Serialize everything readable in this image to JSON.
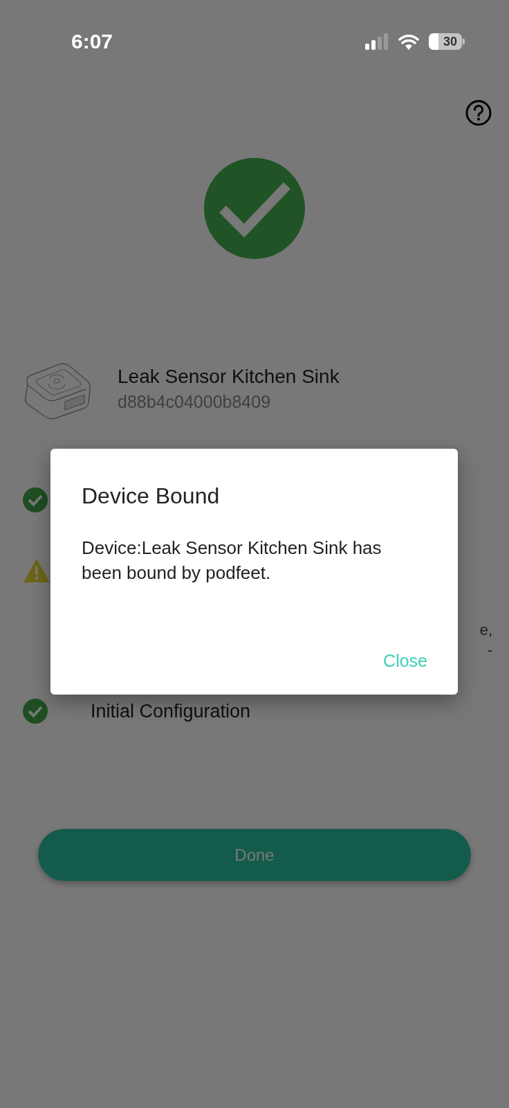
{
  "status_bar": {
    "time": "6:07",
    "battery": "30"
  },
  "device": {
    "name": "Leak Sensor Kitchen Sink",
    "id": "d88b4c04000b8409"
  },
  "steps": [
    {
      "kind": "check"
    },
    {
      "kind": "warning",
      "fragments": [
        "e,",
        "-"
      ]
    },
    {
      "kind": "check",
      "label": "Initial Configuration"
    }
  ],
  "done_button": {
    "label": "Done"
  },
  "dialog": {
    "title": "Device Bound",
    "message": "Device:Leak Sensor Kitchen Sink has been bound by podfeet.",
    "action": "Close"
  }
}
